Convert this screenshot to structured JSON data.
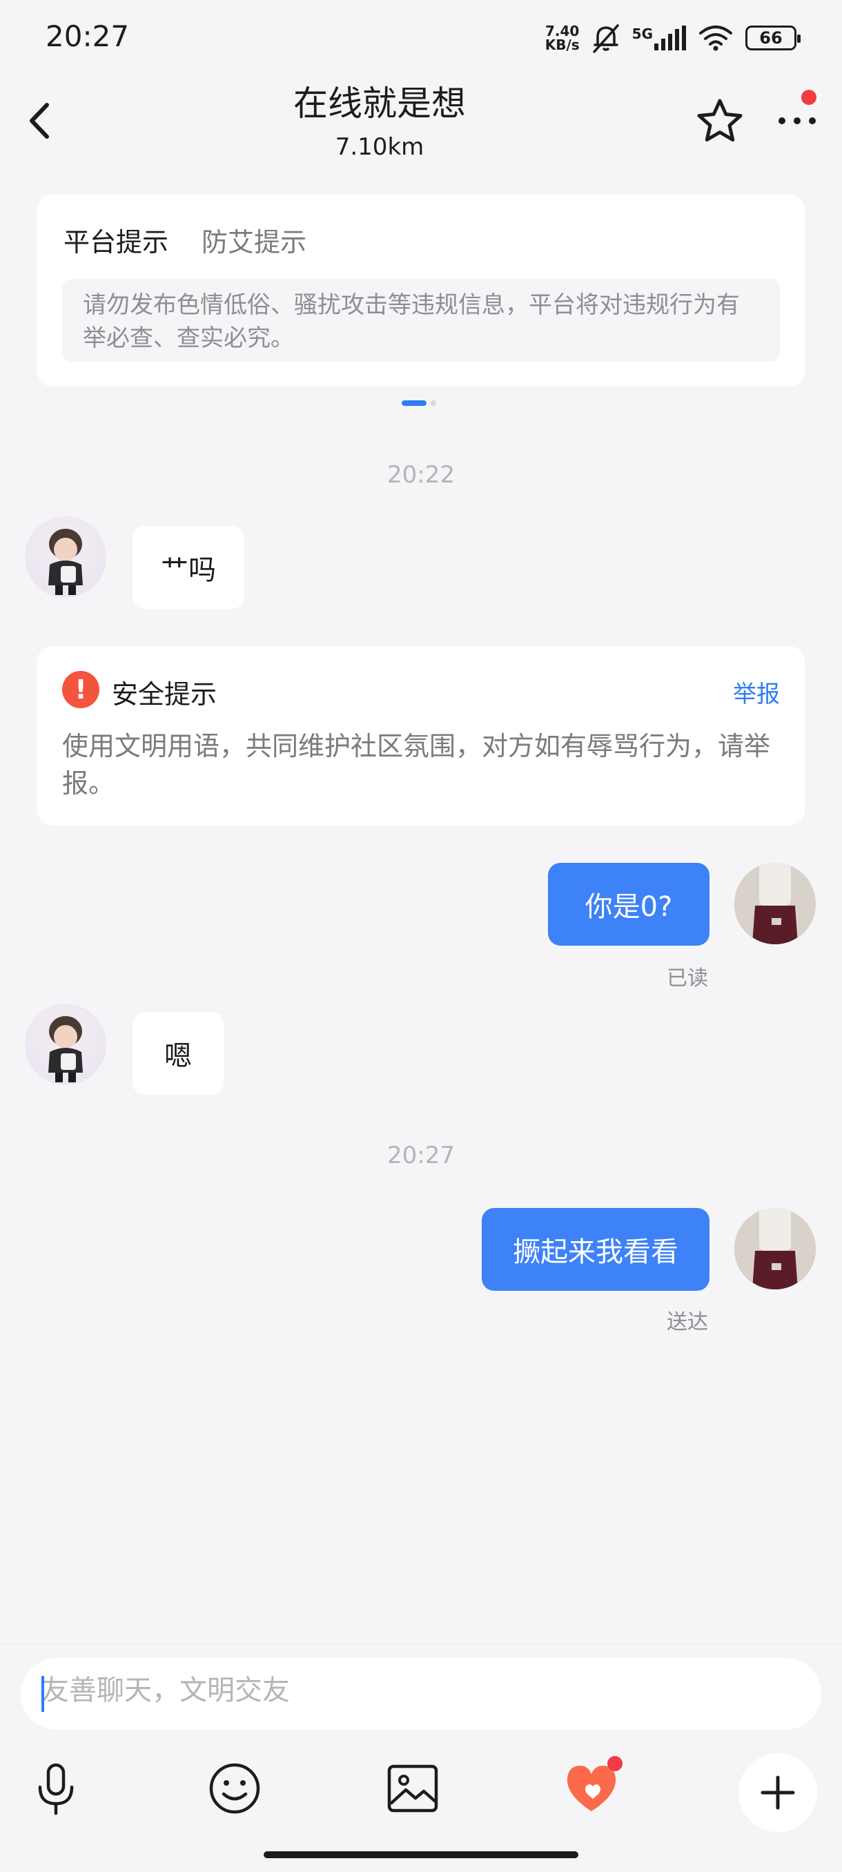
{
  "status_bar": {
    "time": "20:27",
    "net_speed_top": "7.40",
    "net_speed_bottom": "KB/s",
    "network": "5G",
    "battery": "66",
    "icons": [
      "mute-bell-icon",
      "signal-icon",
      "wifi-icon",
      "battery-icon"
    ]
  },
  "header": {
    "title": "在线就是想",
    "distance": "7.10km",
    "icons": [
      "back-arrow-icon",
      "star-icon",
      "more-dots-icon"
    ]
  },
  "notice": {
    "tabs": [
      "平台提示",
      "防艾提示"
    ],
    "body": "请勿发布色情低俗、骚扰攻击等违规信息，平台将对违规行为有举必查、查实必究。"
  },
  "messages": {
    "time1": "20:22",
    "msg1": "艹吗",
    "safety": {
      "title": "安全提示",
      "report": "举报",
      "body": "使用文明用语，共同维护社区氛围，对方如有辱骂行为，请举报。"
    },
    "msg2": "你是0?",
    "receipt2": "已读",
    "msg3": "嗯",
    "time2": "20:27",
    "msg4": "撅起来我看看",
    "receipt4": "送达"
  },
  "composer": {
    "placeholder": "友善聊天，文明交友",
    "tools": [
      "microphone-icon",
      "emoji-icon",
      "image-icon",
      "heart-gift-icon",
      "plus-icon"
    ]
  },
  "colors": {
    "accent": "#3d82f7",
    "background": "#f5f5f7",
    "alert": "#f4533d",
    "badge": "#f23b43"
  }
}
